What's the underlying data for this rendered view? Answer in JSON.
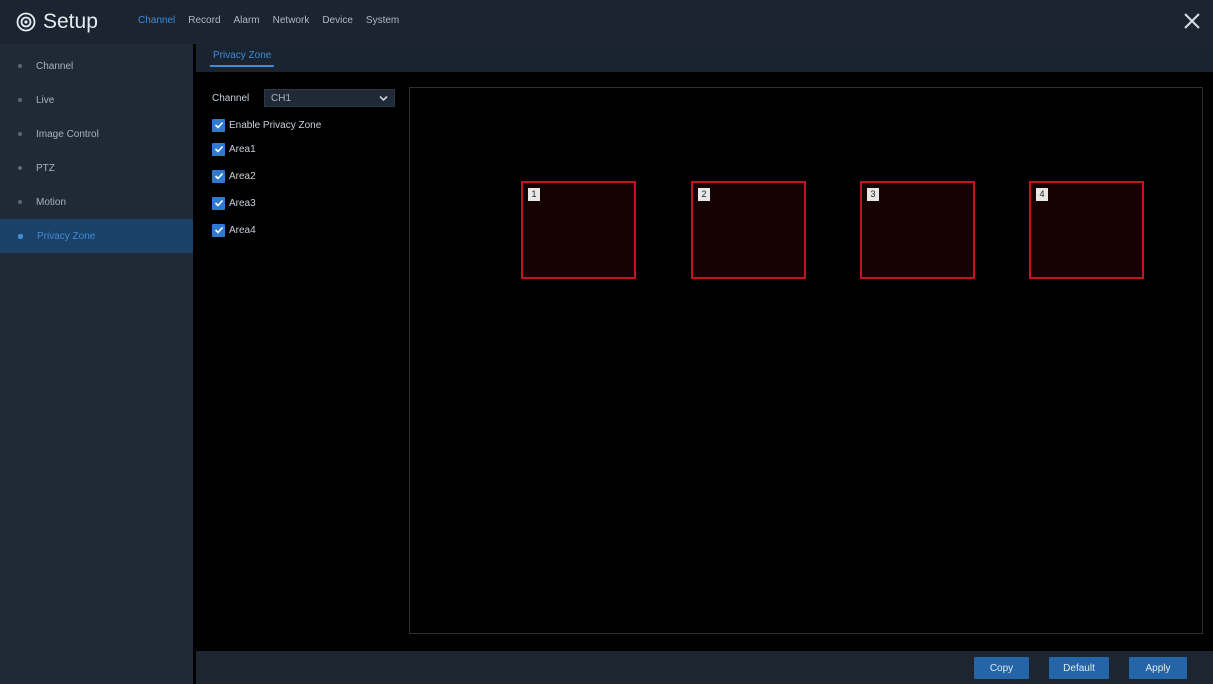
{
  "header": {
    "title": "Setup",
    "tabs": [
      {
        "label": "Channel",
        "active": true
      },
      {
        "label": "Record"
      },
      {
        "label": "Alarm"
      },
      {
        "label": "Network"
      },
      {
        "label": "Device"
      },
      {
        "label": "System"
      }
    ],
    "icons": {
      "logo": "gear-icon",
      "close": "close-icon"
    }
  },
  "sidebar": {
    "items": [
      {
        "label": "Channel"
      },
      {
        "label": "Live"
      },
      {
        "label": "Image Control"
      },
      {
        "label": "PTZ"
      },
      {
        "label": "Motion"
      },
      {
        "label": "Privacy Zone",
        "active": true
      }
    ]
  },
  "subtab": {
    "label": "Privacy Zone"
  },
  "form": {
    "channel_label": "Channel",
    "channel_value": "CH1",
    "enable_label": "Enable Privacy Zone",
    "areas": [
      "Area1",
      "Area2",
      "Area3",
      "Area4"
    ]
  },
  "preview": {
    "zones": [
      {
        "number": "1"
      },
      {
        "number": "2"
      },
      {
        "number": "3"
      },
      {
        "number": "4"
      }
    ]
  },
  "footer": {
    "copy_label": "Copy",
    "default_label": "Default",
    "apply_label": "Apply"
  },
  "colors": {
    "accent": "#3f8bd6",
    "zone_border": "#c2141e",
    "button": "#2465a8"
  }
}
